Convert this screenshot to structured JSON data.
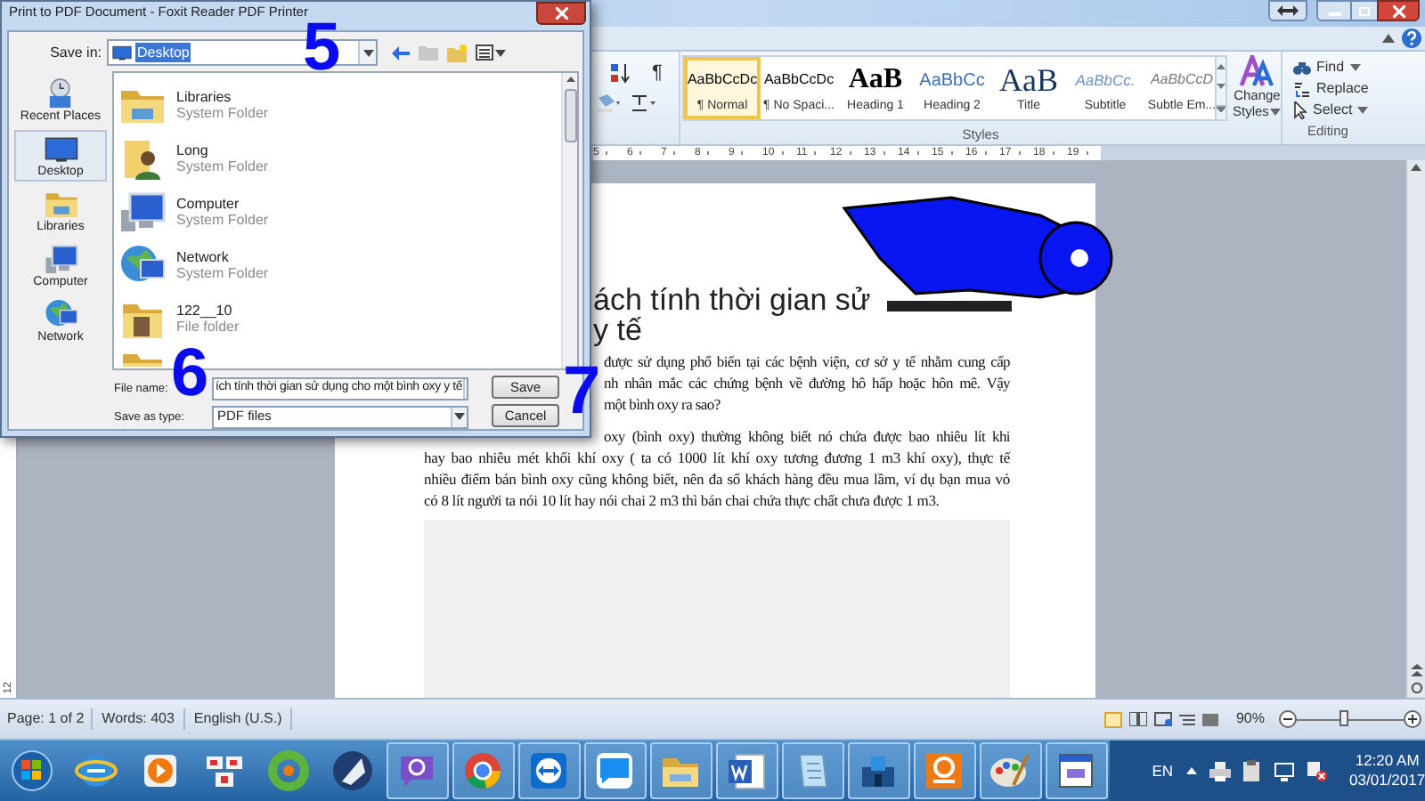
{
  "dialog": {
    "title": "Print to PDF Document - Foxit Reader PDF Printer",
    "save_in": {
      "label": "Save in:",
      "value": "Desktop"
    },
    "places": [
      {
        "label": "Recent Places",
        "kind": "recent",
        "selected": false
      },
      {
        "label": "Desktop",
        "kind": "desktop",
        "selected": true
      },
      {
        "label": "Libraries",
        "kind": "libraries",
        "selected": false
      },
      {
        "label": "Computer",
        "kind": "computer",
        "selected": false
      },
      {
        "label": "Network",
        "kind": "network",
        "selected": false
      }
    ],
    "files": [
      {
        "name": "Libraries",
        "type": "System Folder",
        "kind": "libraries"
      },
      {
        "name": "Long",
        "type": "System Folder",
        "kind": "user"
      },
      {
        "name": "Computer",
        "type": "System Folder",
        "kind": "computer"
      },
      {
        "name": "Network",
        "type": "System Folder",
        "kind": "network"
      },
      {
        "name": "122__10",
        "type": "File folder",
        "kind": "folder"
      }
    ],
    "file_name": {
      "label": "File name:",
      "value": "ích tính thời gian sử dụng cho một bình oxy y tế"
    },
    "save_as_type": {
      "label": "Save as type:",
      "value": "PDF files"
    },
    "buttons": [
      "Save",
      "Cancel"
    ]
  },
  "annotations": [
    "5",
    "6",
    "7"
  ],
  "ribbon": {
    "paragraph_mark": "¶",
    "styles": [
      {
        "sample": "AaBbCcDc",
        "label": "¶ Normal",
        "kind": "normal",
        "selected": true
      },
      {
        "sample": "AaBbCcDc",
        "label": "¶ No Spaci...",
        "kind": "normal",
        "selected": false
      },
      {
        "sample": "AaB",
        "label": "Heading 1",
        "kind": "heading1",
        "selected": false
      },
      {
        "sample": "AaBbCc",
        "label": "Heading 2",
        "kind": "heading2",
        "selected": false
      },
      {
        "sample": "AaB",
        "label": "Title",
        "kind": "title",
        "selected": false
      },
      {
        "sample": "AaBbCc.",
        "label": "Subtitle",
        "kind": "subtitle",
        "selected": false
      },
      {
        "sample": "AaBbCcD",
        "label": "Subtle Em...",
        "kind": "emphasis",
        "selected": false
      }
    ],
    "change_styles": [
      "Change",
      "Styles"
    ],
    "styles_group": "Styles",
    "editing": [
      "Find",
      "Replace",
      "Select"
    ],
    "editing_group": "Editing"
  },
  "ruler": {
    "numbers": [
      "5",
      "6",
      "7",
      "8",
      "9",
      "10",
      "11",
      "12",
      "13",
      "14",
      "15",
      "16",
      "17",
      "18",
      "19"
    ],
    "vertical": "12"
  },
  "document": {
    "heading_lines": [
      "ách tính thời gian sử",
      "y tế"
    ],
    "paragraphs": [
      {
        "lines": [
          "được sử dụng phổ biến tại các bệnh viện, cơ sở y tế nhằm cung cấp",
          "nh nhân mắc các chứng bệnh về đường hô hấp hoặc hôn mê. Vậy",
          "một bình oxy ra sao?"
        ]
      },
      {
        "lines": [
          "oxy (bình oxy) thường không biết nó chứa được bao nhiêu lít khi",
          "hay bao nhiêu mét khối khí oxy ( ta có 1000 lít khí oxy tương đương 1 m3 khí oxy), thực tế",
          "nhiều điểm bán bình oxy cũng không biết, nên đa số khách hàng đều mua lầm, ví dụ bạn mua vỏ",
          "có 8 lít người ta nói 10 lít hay nói chai 2 m3 thì bán chai chứa thực chất chưa được 1 m3."
        ]
      }
    ]
  },
  "status_bar": {
    "page": "Page: 1 of 2",
    "words": "Words: 403",
    "language": "English (U.S.)",
    "zoom": "90%",
    "zoom_slider": {
      "level": 0.45
    }
  },
  "taskbar": {
    "items": [
      {
        "kind": "start",
        "running": false
      },
      {
        "kind": "globe",
        "running": false
      },
      {
        "kind": "media",
        "running": false
      },
      {
        "kind": "tiles",
        "running": false
      },
      {
        "kind": "ring",
        "running": false
      },
      {
        "kind": "quill",
        "running": false
      },
      {
        "kind": "chat",
        "running": true
      },
      {
        "kind": "browser",
        "running": true
      },
      {
        "kind": "arrows",
        "running": true
      },
      {
        "kind": "bubble",
        "running": true
      },
      {
        "kind": "folder",
        "running": true
      },
      {
        "kind": "word",
        "running": true
      },
      {
        "kind": "notepad",
        "running": true
      },
      {
        "kind": "network",
        "running": true
      },
      {
        "kind": "pdf",
        "running": true
      },
      {
        "kind": "palette",
        "running": true
      },
      {
        "kind": "window",
        "running": true
      }
    ],
    "tray": {
      "language": "EN",
      "time": "12:20 AM",
      "date": "03/01/2017"
    }
  }
}
